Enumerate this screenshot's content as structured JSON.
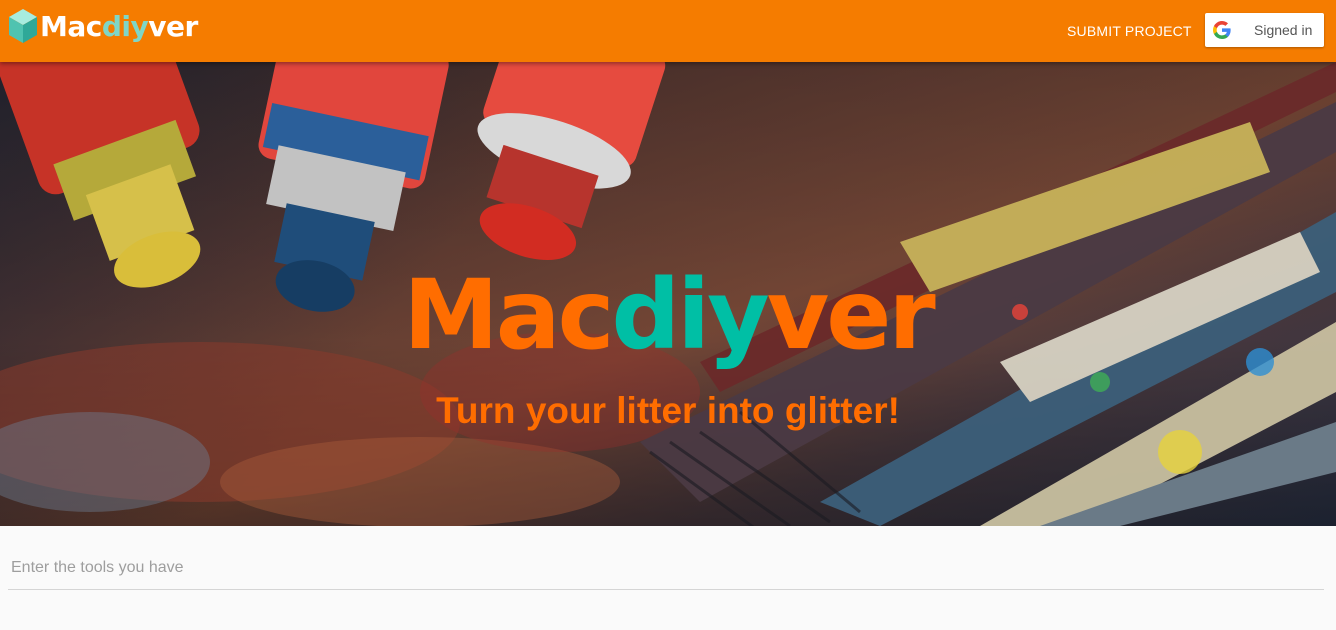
{
  "navbar": {
    "brand": {
      "part1": "Mac",
      "part2": "diy",
      "part3": "ver",
      "icon": "cube-logo-icon"
    },
    "submit_label": "SUBMIT PROJECT",
    "signin_label": "Signed in",
    "signin_icon": "google-icon",
    "bg_color": "#f57c00"
  },
  "hero": {
    "title": {
      "part1": "Mac",
      "part2": "diy",
      "part3": "ver"
    },
    "subtitle": "Turn your litter into glitter!",
    "title_color": "#ff6d00",
    "accent_color": "#00bfa5"
  },
  "search": {
    "placeholder": "Enter the tools you have",
    "value": ""
  }
}
